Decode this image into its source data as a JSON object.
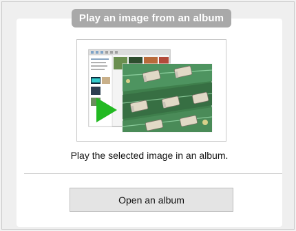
{
  "header": {
    "title": "Play an image from an album"
  },
  "preview": {
    "icon": "play-icon",
    "accent": "#22b922"
  },
  "description": "Play the selected image in an album.",
  "actions": {
    "open_album_label": "Open an album"
  }
}
